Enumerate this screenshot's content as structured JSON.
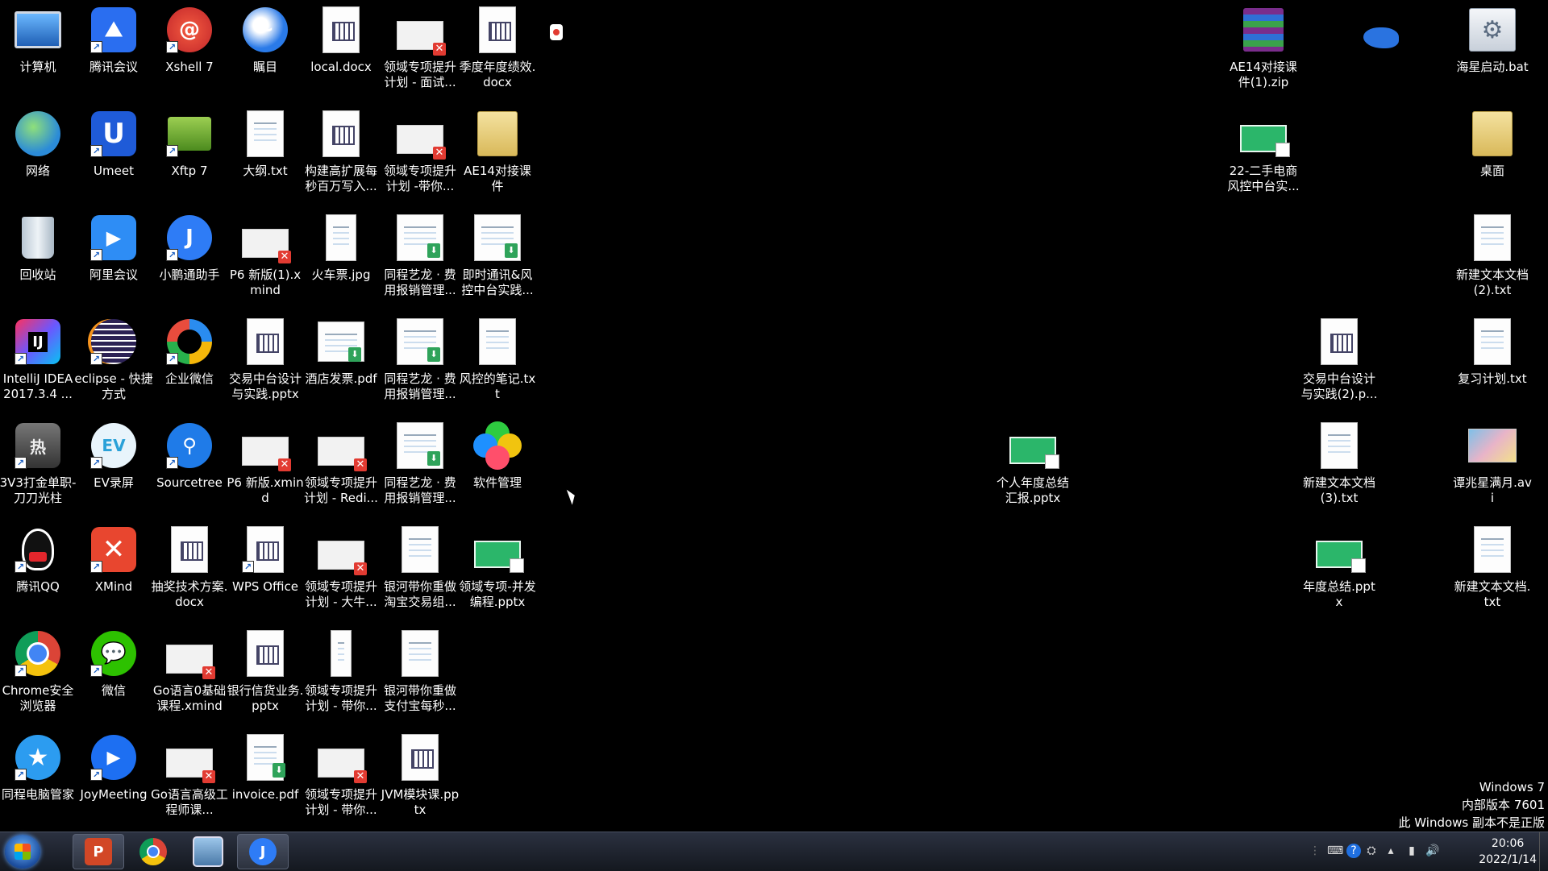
{
  "desktop": {
    "icons": {
      "computer": "计算机",
      "tencent_meeting": "腾讯会议",
      "xshell": "Xshell 7",
      "tiaomu": "瞩目",
      "local_docx": "local.docx",
      "plan_interview": "领域专项提升计划 - 面试...",
      "quarterly_perf": "季度年度绩效.docx",
      "network": "网络",
      "umeet": "Umeet",
      "xftp": "Xftp 7",
      "outline_txt": "大纲.txt",
      "build_extensible": "构建高扩展每秒百万写入...",
      "plan_take_you": "领域专项提升计划 -带你...",
      "ae14_folder": "AE14对接课件",
      "recycle_bin": "回收站",
      "ali_meeting": "阿里会议",
      "xiaopeng": "小鹏通助手",
      "p6_new_1": "P6 新版(1).xmind",
      "train_ticket": "火车票.jpg",
      "tongcheng_1": "同程艺龙 · 费用报销管理...",
      "im_risk": "即时通讯&风控中台实践...",
      "intellij": "IntelliJ IDEA 2017.3.4 ...",
      "eclipse": "eclipse - 快捷方式",
      "wecom": "企业微信",
      "trade_center": "交易中台设计与实践.pptx",
      "hotel_invoice": "酒店发票.pdf",
      "tongcheng_2": "同程艺龙 · 费用报销管理...",
      "risk_notes": "风控的笔记.txt",
      "game_3v3": "3V3打金单职-刀刀光柱",
      "ev_recorder": "EV录屏",
      "sourcetree": "Sourcetree",
      "p6_new": "P6 新版.xmind",
      "plan_redis": "领域专项提升计划 - Redi...",
      "tongcheng_3": "同程艺龙 · 费用报销管理...",
      "software_mgr": "软件管理",
      "tencent_qq": "腾讯QQ",
      "xmind": "XMind",
      "lottery_doc": "抽奖技术方案.docx",
      "wps_office": "WPS Office",
      "plan_big": "领域专项提升计划 - 大牛...",
      "galaxy_taobao": "银河带你重做淘宝交易组...",
      "domain_concurrency": "领域专项-并发编程.pptx",
      "chrome": "Chrome安全浏览器",
      "wechat": "微信",
      "go_basic": "Go语言0基础课程.xmind",
      "bank_credit": "银行信货业务.pptx",
      "plan_take_you_2": "领域专项提升计划 - 带你...",
      "galaxy_alipay": "银河带你重做支付宝每秒...",
      "tongcheng_mgr": "同程电脑管家",
      "joymeeting": "JoyMeeting",
      "go_advanced": "Go语言高级工程师课...",
      "invoice_pdf": "invoice.pdf",
      "plan_take_you_3": "领域专项提升计划 - 带你...",
      "jvm_pptx": "JVM模块课.pptx",
      "ae14_zip": "AE14对接课件(1).zip",
      "haixing_bat": "海星启动.bat",
      "secondhand_risk": "22-二手电商风控中台实...",
      "desktop_folder": "桌面",
      "new_txt_2": "新建文本文档(2).txt",
      "trade_center_2": "交易中台设计与实践(2).p...",
      "review_plan": "复习计划.txt",
      "annual_report": "个人年度总结汇报.pptx",
      "new_txt_3": "新建文本文档(3).txt",
      "avi_video": "谭兆星满月.avi",
      "annual_summary": "年度总结.pptx",
      "new_txt": "新建文本文档.txt"
    }
  },
  "watermark": {
    "line1": "Windows 7",
    "line2": "内部版本 7601",
    "line3": "此 Windows 副本不是正版"
  },
  "taskbar": {
    "apps": [
      "PowerPoint",
      "Chrome",
      "Remote Desktop",
      "Xiaopeng"
    ],
    "clock_time": "20:06",
    "clock_date": "2022/1/14"
  },
  "colors": {
    "desktop_bg": "#000000",
    "taskbar_bg": "#1d222c"
  }
}
